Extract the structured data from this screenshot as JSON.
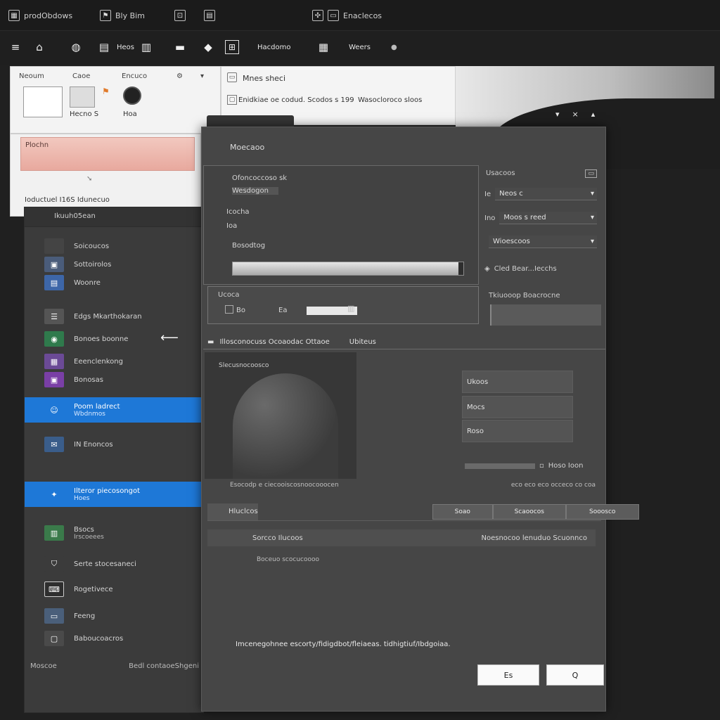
{
  "menubar": {
    "items": [
      {
        "label": "prodObdows"
      },
      {
        "label": "Bly Bim"
      },
      {
        "label": ""
      },
      {
        "label": ""
      },
      {
        "label": "Enaclecos"
      }
    ]
  },
  "toolbar": {
    "items": [
      {
        "label": "Heos"
      },
      {
        "label": ""
      },
      {
        "label": ""
      },
      {
        "label": "Hacdomo"
      },
      {
        "label": "Weers"
      }
    ]
  },
  "doc_panel": {
    "tabs": [
      "Neoum",
      "Caoe",
      "Encuco"
    ],
    "thumb_captions": [
      "Hecno S",
      "Hoa"
    ],
    "recent_label": "Plochn",
    "footer": "Ioductuel I16S Idunecuo"
  },
  "info_panel": {
    "title": "Mnes sheci",
    "line": "Enidkiae oe codud. Scodos s 199",
    "line2": "Wasocloroco sloos"
  },
  "nav": {
    "header": "Ikuuh05ean",
    "items": [
      {
        "label": "Soicoucos"
      },
      {
        "label": "Sottoirolos"
      },
      {
        "label": "Woonre"
      },
      {
        "label": "Edgs Mkarthokaran"
      },
      {
        "label": "Bonoes boonne"
      },
      {
        "label": "Eeenclenkong"
      },
      {
        "label": "Bonosas"
      },
      {
        "label": "Poom ladrect",
        "sub": "Wbdnmos"
      },
      {
        "label": "IN Enoncos"
      },
      {
        "label": "Ilteror piecosongot",
        "sub": "Hoes"
      },
      {
        "label": "Bsocs",
        "sub": "Irscoeees"
      },
      {
        "label": "Serte stocesaneci"
      },
      {
        "label": "Rogetivece"
      },
      {
        "label": "Feeng"
      },
      {
        "label": "Baboucoacros"
      }
    ],
    "footer_left": "Moscoe",
    "footer_right": "Bedl contaoeShgeni"
  },
  "dialog": {
    "title": "Moecaoo",
    "form": {
      "label1": "Ofoncoccoso sk",
      "label2": "Wesdogon",
      "label3": "Icocha",
      "label4": "Ioa",
      "label5": "Bosodtog",
      "progress": 0.98
    },
    "side": {
      "header": "Usacoos",
      "rows": [
        {
          "label": "Ie",
          "value": "Neos c"
        },
        {
          "label": "Ino",
          "value": "Moos s reed"
        },
        {
          "label": "",
          "value": "Wioescoos"
        }
      ],
      "status": "Cled Bear...Iecchs"
    },
    "row2": {
      "label": "Ucoca",
      "field1": "Bo",
      "field2": "Ea"
    },
    "find": {
      "label": "Tkiuooop Boacrocne"
    },
    "section": {
      "label": "Illosconocuss Ocoaodac Ottaoe",
      "right": "Ubiteus"
    },
    "preview_label": "Slecusnocoosco",
    "options": [
      "Ukoos",
      "Mocs",
      "Roso"
    ],
    "zoom_label": "Hoso Ioon",
    "caption_left": "Esocodp e ciecooiscosnoocooocen",
    "caption_right": "eco eco eco occeco co coa",
    "table": {
      "header": "Hluclcos",
      "segments": [
        "Soao",
        "Scaoocos",
        "Sooosco"
      ],
      "row_left": "Sorcco  Ilucoos",
      "row_right": "Noesnocoo lenuduo  Scuonnco",
      "sub": "Boceuo scocucoooo"
    },
    "status_line": "Imcenegohnee escorty/fidigdbot/fleiaeas. tidhigtiuf/Ibdgoiaa.",
    "buttons": {
      "ok": "Es",
      "search": "Q"
    }
  },
  "colors": {
    "accent": "#1e78d7",
    "rec_pink": "#f2c8bf"
  }
}
